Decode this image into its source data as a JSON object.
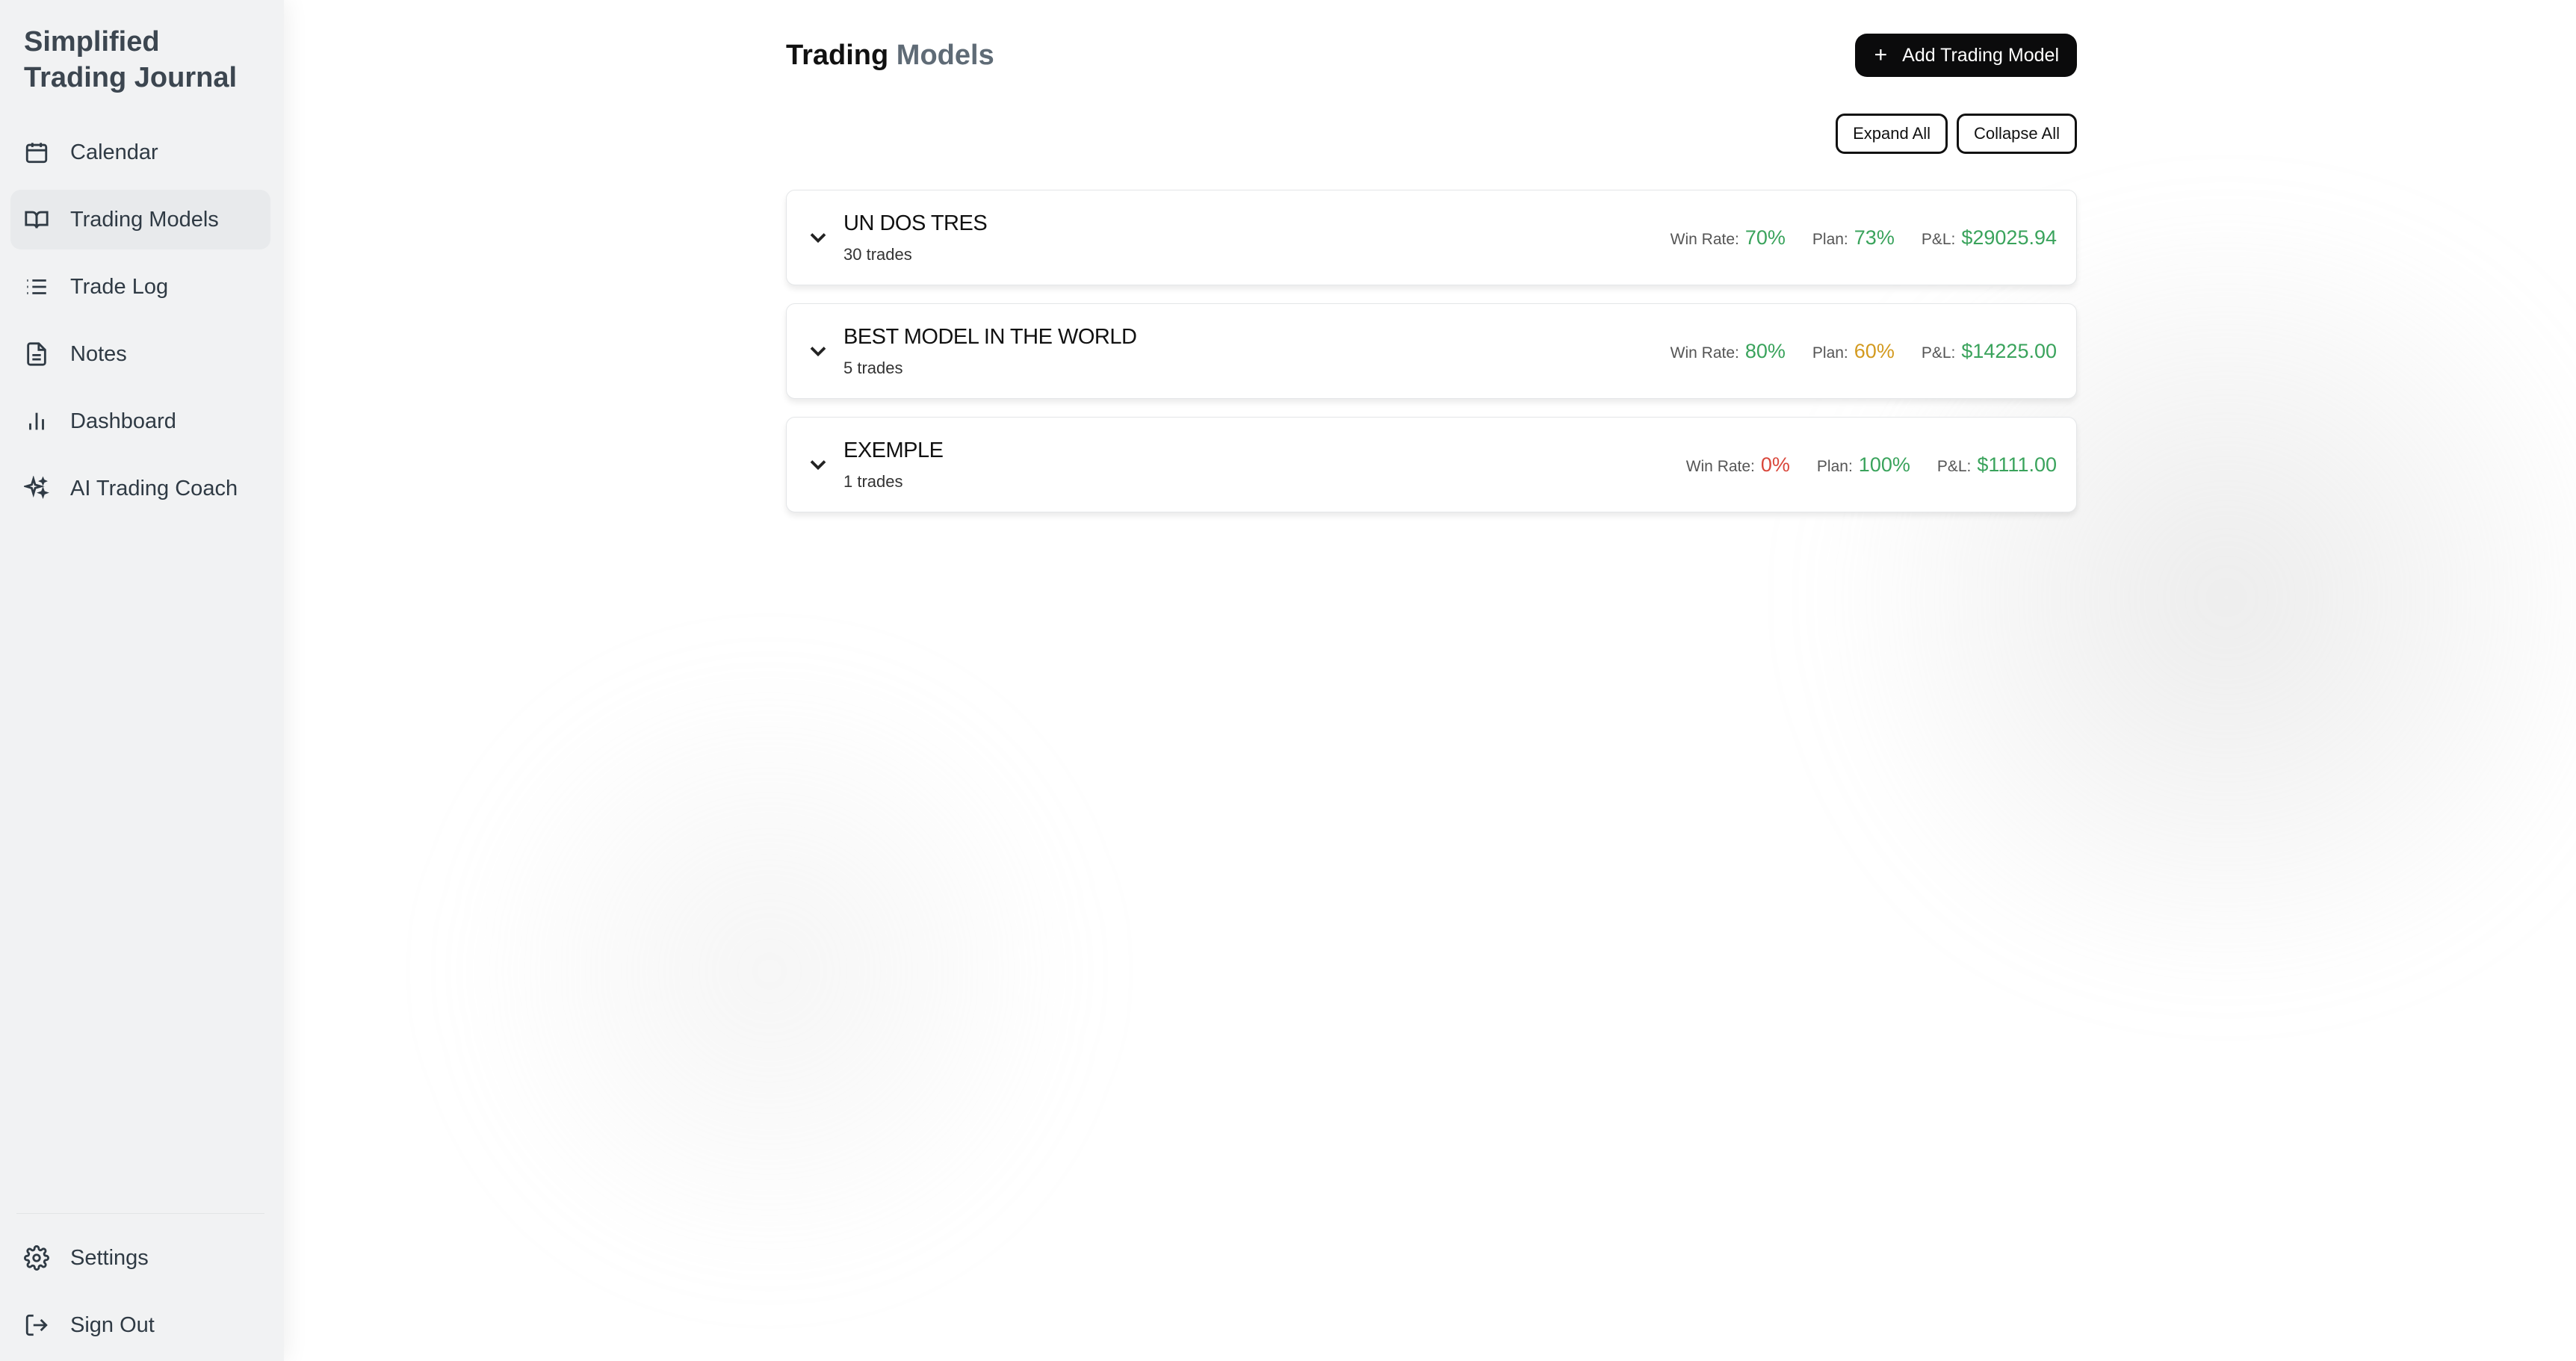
{
  "sidebar": {
    "brand_line1": "Simplified",
    "brand_line2": "Trading Journal",
    "items": [
      {
        "label": "Calendar",
        "icon": "calendar-icon"
      },
      {
        "label": "Trading Models",
        "icon": "book-icon",
        "active": true
      },
      {
        "label": "Trade Log",
        "icon": "list-icon"
      },
      {
        "label": "Notes",
        "icon": "document-icon"
      },
      {
        "label": "Dashboard",
        "icon": "bar-chart-icon"
      },
      {
        "label": "AI Trading Coach",
        "icon": "sparkles-icon"
      }
    ],
    "bottom_items": [
      {
        "label": "Settings",
        "icon": "gear-icon"
      },
      {
        "label": "Sign Out",
        "icon": "sign-out-icon"
      }
    ]
  },
  "header": {
    "title_part1": "Trading",
    "title_part2": "Models",
    "add_button_label": "Add Trading Model"
  },
  "toolbar": {
    "expand_label": "Expand All",
    "collapse_label": "Collapse All"
  },
  "labels": {
    "win_rate": "Win Rate:",
    "plan": "Plan:",
    "pnl": "P&L:"
  },
  "colors": {
    "green": "#3aa35c",
    "amber": "#d39a1f",
    "red": "#d9473b"
  },
  "models": [
    {
      "name": "UN DOS TRES",
      "trades": "30 trades",
      "win_rate": "70%",
      "win_rate_color": "#3aa35c",
      "plan": "73%",
      "plan_color": "#3aa35c",
      "pnl": "$29025.94",
      "pnl_color": "#3aa35c"
    },
    {
      "name": "BEST MODEL IN THE WORLD",
      "trades": "5 trades",
      "win_rate": "80%",
      "win_rate_color": "#3aa35c",
      "plan": "60%",
      "plan_color": "#d39a1f",
      "pnl": "$14225.00",
      "pnl_color": "#3aa35c"
    },
    {
      "name": "EXEMPLE",
      "trades": "1 trades",
      "win_rate": "0%",
      "win_rate_color": "#d9473b",
      "plan": "100%",
      "plan_color": "#3aa35c",
      "pnl": "$1111.00",
      "pnl_color": "#3aa35c"
    }
  ]
}
